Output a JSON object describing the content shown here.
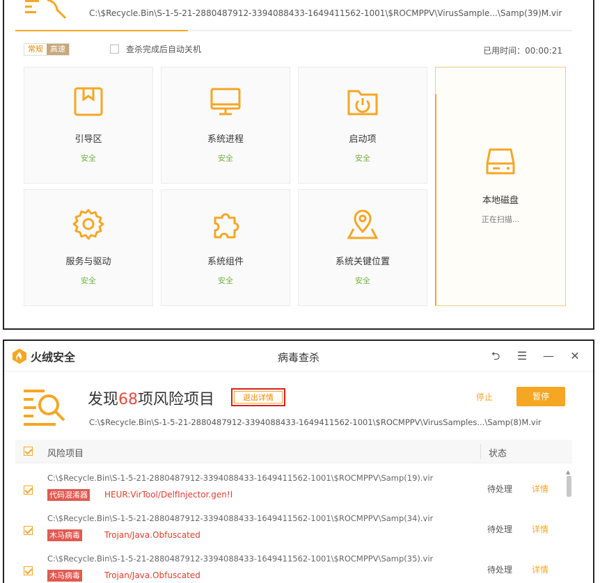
{
  "colors": {
    "accent": "#f5a623",
    "safe": "#6fb23d",
    "danger": "#e84a3c",
    "tag_bg": "#e05a52"
  },
  "scan_top": {
    "path": "C:\\$Recycle.Bin\\S-1-5-21-2880487912-3394088433-1649411562-1001\\$ROCMPPV\\VirusSample...\\Samp(39)M.vir",
    "progress_fraction": 0.31,
    "mode_normal": "常规",
    "mode_fast": "高速",
    "auto_shutdown_label": "查杀完成后自动关机",
    "elapsed_time": "已用时间：00:00:21",
    "cards": [
      {
        "name": "引导区",
        "status": "安全",
        "icon": "bookmark-book-icon"
      },
      {
        "name": "系统进程",
        "status": "安全",
        "icon": "monitor-icon"
      },
      {
        "name": "启动项",
        "status": "安全",
        "icon": "power-folder-icon"
      },
      {
        "name": "服务与驱动",
        "status": "安全",
        "icon": "gear-icon"
      },
      {
        "name": "系统组件",
        "status": "安全",
        "icon": "puzzle-icon"
      },
      {
        "name": "系统关键位置",
        "status": "安全",
        "icon": "location-pin-icon"
      }
    ],
    "local_disk": {
      "name": "本地磁盘",
      "status": "正在扫描...",
      "icon": "hard-disk-icon"
    }
  },
  "window": {
    "brand": "火绒安全",
    "title": "病毒查杀",
    "controls": {
      "back": "⮌",
      "menu": "☰",
      "minimize": "—",
      "close": "✕"
    }
  },
  "results": {
    "found_prefix": "发现",
    "found_count": "68",
    "found_suffix": "项风险项目",
    "export_label": "退出详情",
    "stop_label": "停止",
    "pause_label": "暂停",
    "current_path": "C:\\$Recycle.Bin\\S-1-5-21-2880487912-3394088433-1649411562-1001\\$ROCMPPV\\VirusSamples...\\Samp(8)M.vir",
    "col_risk": "风险项目",
    "col_state": "状态",
    "rows": [
      {
        "path": "C:\\$Recycle.Bin\\S-1-5-21-2880487912-3394088433-1649411562-1001\\$ROCMPPV\\Samp(19).vir",
        "tag": "代码混淆器",
        "virus": "HEUR:VirTool/DelfInjector.gen!I",
        "state": "待处理",
        "detail": "详情"
      },
      {
        "path": "C:\\$Recycle.Bin\\S-1-5-21-2880487912-3394088433-1649411562-1001\\$ROCMPPV\\Samp(34).vir",
        "tag": "木马病毒",
        "virus": "Trojan/Java.Obfuscated",
        "state": "待处理",
        "detail": "详情"
      },
      {
        "path": "C:\\$Recycle.Bin\\S-1-5-21-2880487912-3394088433-1649411562-1001\\$ROCMPPV\\Samp(35).vir",
        "tag": "木马病毒",
        "virus": "Trojan/Java.Obfuscated",
        "state": "待处理",
        "detail": "详情"
      }
    ]
  }
}
